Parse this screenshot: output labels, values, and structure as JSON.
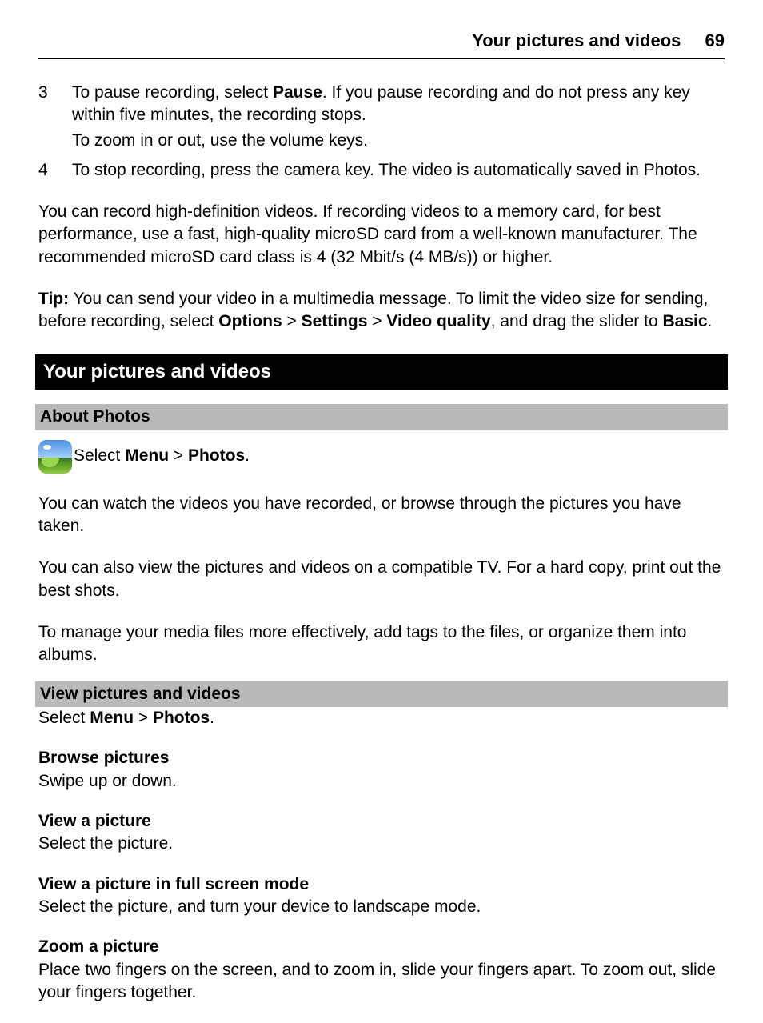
{
  "header": {
    "title": "Your pictures and videos",
    "page_number": "69"
  },
  "steps": {
    "s3": {
      "num": "3",
      "line1_a": "To pause recording, select ",
      "line1_b": "Pause",
      "line1_c": ". If you pause recording and do not press any key within five minutes, the recording stops.",
      "line2": "To zoom in or out, use the volume keys."
    },
    "s4": {
      "num": "4",
      "text": "To stop recording, press the camera key. The video is automatically saved in Photos."
    }
  },
  "hd_para": "You can record high-definition videos. If recording videos to a memory card, for best performance, use a fast, high-quality microSD card from a well-known manufacturer. The recommended microSD card class is 4 (32 Mbit/s (4 MB/s)) or higher.",
  "tip": {
    "label": "Tip:",
    "a": " You can send your video in a multimedia message. To limit the video size for sending, before recording, select ",
    "b1": "Options",
    "gt": " > ",
    "b2": "Settings",
    "b3": "Video quality",
    "c": ", and drag the slider to ",
    "b4": "Basic",
    "d": "."
  },
  "section_title": "Your pictures and videos",
  "about": {
    "title": "About Photos",
    "select_a": "Select ",
    "menu": "Menu",
    "gt": " > ",
    "photos": "Photos",
    "dot": ".",
    "p1": "You can watch the videos you have recorded, or browse through the pictures you have taken.",
    "p2": "You can also view the pictures and videos on a compatible TV. For a hard copy, print out the best shots.",
    "p3": "To manage your media files more effectively, add tags to the files, or organize them into albums."
  },
  "view": {
    "title": "View pictures and videos",
    "select_a": "Select ",
    "menu": "Menu",
    "gt": " > ",
    "photos": "Photos",
    "dot": "."
  },
  "tasks": {
    "browse": {
      "title": "Browse pictures",
      "body": "Swipe up or down."
    },
    "view_picture": {
      "title": "View a picture",
      "body": "Select the picture."
    },
    "fullscreen": {
      "title": "View a picture in full screen mode",
      "body": "Select the picture, and turn your device to landscape mode."
    },
    "zoom": {
      "title": "Zoom a picture",
      "body": "Place two fingers on the screen, and to zoom in, slide your fingers apart. To zoom out, slide your fingers together."
    }
  }
}
